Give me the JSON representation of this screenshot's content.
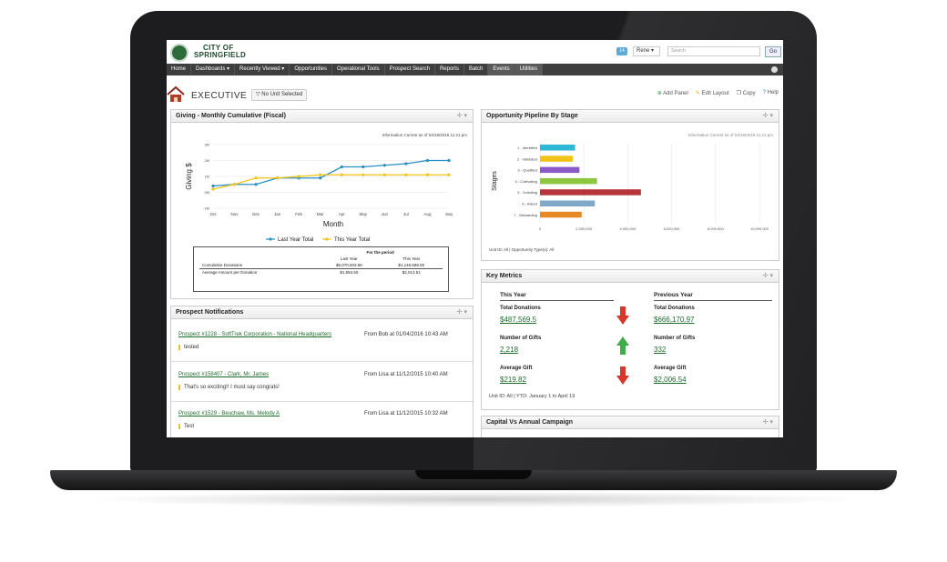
{
  "header": {
    "logo_line1": "CITY OF",
    "logo_line2": "SPRINGFIELD",
    "badge": "14",
    "user": "Rene",
    "search_placeholder": "Search",
    "go": "Go"
  },
  "nav": [
    "Home",
    "Dashboards ▾",
    "Recently Viewed ▾",
    "Opportunities",
    "Operational Tools",
    "Prospect Search",
    "Reports",
    "Batch",
    "Events",
    "Utilities"
  ],
  "title": {
    "label": "EXECUTIVE",
    "unit": "No Unit Selected"
  },
  "tools": {
    "add_panel": "Add Panel",
    "edit_layout": "Edit Layout",
    "copy": "Copy",
    "help": "Help"
  },
  "giving": {
    "title": "Giving - Monthly Cumulative (Fiscal)",
    "info": "Information Current as of 04/18/2016 11:21 pm",
    "summary": {
      "caption": "For the period",
      "col1": "Last Year",
      "col2": "This Year",
      "rows": [
        {
          "label": "Cumulative Donations",
          "last": "$5,070,503.56",
          "this": "$1,146,688.50"
        },
        {
          "label": "Average Amount per Donation",
          "last": "$1,584.60",
          "this": "$2,013.51"
        }
      ]
    }
  },
  "chart_data": [
    {
      "type": "line",
      "title": "",
      "xlabel": "Month",
      "ylabel": "Giving $",
      "categories": [
        "Oct",
        "Nov",
        "Dec",
        "Jan",
        "Feb",
        "Mar",
        "Apr",
        "May",
        "Jun",
        "Jul",
        "Aug",
        "Sep"
      ],
      "yticks": [
        "3M",
        "2M",
        "1M",
        "0M",
        "-1M"
      ],
      "ylim": [
        -1,
        3
      ],
      "series": [
        {
          "name": "Last Year Total",
          "color": "#2a8fc1",
          "values": [
            0.4,
            0.5,
            0.5,
            0.9,
            0.9,
            0.9,
            1.6,
            1.6,
            1.7,
            1.8,
            2.0,
            2.0
          ]
        },
        {
          "name": "This Year Total",
          "color": "#f0c419",
          "values": [
            0.2,
            0.5,
            0.9,
            0.9,
            1.0,
            1.1,
            1.1,
            1.1,
            1.1,
            1.1,
            1.1,
            1.1
          ]
        }
      ],
      "legend": "bottom"
    },
    {
      "type": "bar",
      "title": "",
      "ylabel": "Stages",
      "orientation": "horizontal",
      "categories": [
        "1 - Identified",
        "2 - Validated",
        "3 - Qualified",
        "4 - Cultivating",
        "5 - Soliciting",
        "6 - Asked",
        "7 - Stewarding"
      ],
      "xticks": [
        "0",
        "2,000,000",
        "4,000,000",
        "6,000,000",
        "8,000,000",
        "10,000,000"
      ],
      "xlim": [
        0,
        10000000
      ],
      "values": [
        1600000,
        1500000,
        1800000,
        2600000,
        4600000,
        2500000,
        1900000
      ],
      "colors": [
        "#2fb7d6",
        "#f2c21b",
        "#8a5ac8",
        "#8dc63f",
        "#b8353b",
        "#7fa8c9",
        "#e68a26"
      ],
      "legend": "none"
    }
  ],
  "pipeline": {
    "title": "Opportunity Pipeline By Stage",
    "info": "Information Current as of 04/18/2016 11:21 pm",
    "footer": "Unit ID: All | Opportunity Type(s): All"
  },
  "prospects": {
    "title": "Prospect Notifications",
    "items": [
      {
        "link": "Prospect #1228 - SoftTrek Corporation - National Headquarters",
        "from": "From Bob at 01/04/2016 10:43 AM",
        "msg": "tested"
      },
      {
        "link": "Prospect #158407 - Clark, Mr. James",
        "from": "From Lisa at 11/12/2015 10:40 AM",
        "msg": "That's so exciting!! I must say congrats!"
      },
      {
        "link": "Prospect #1529 - Beuchaw, Ms. Melody A",
        "from": "From Lisa at 11/12/2015 10:32 AM",
        "msg": "Test"
      }
    ]
  },
  "metrics": {
    "title": "Key Metrics",
    "this_year": "This Year",
    "previous_year": "Previous Year",
    "rows": [
      {
        "label": "Total Donations",
        "this": "$487,569.5",
        "prev": "$666,170.97",
        "trend": "down"
      },
      {
        "label": "Number of Gifts",
        "this": "2,218",
        "prev": "332",
        "trend": "up"
      },
      {
        "label": "Average Gift",
        "this": "$219.82",
        "prev": "$2,006.54",
        "trend": "down"
      }
    ],
    "footer": "Unit ID: All | YTD: January 1 to April 19"
  },
  "capital": {
    "title": "Capital Vs Annual Campaign"
  },
  "colors": {
    "nav_bg": "#3e3e3e",
    "link_green": "#1e6b2e",
    "down_red": "#d9362b",
    "up_green": "#3fae49"
  }
}
